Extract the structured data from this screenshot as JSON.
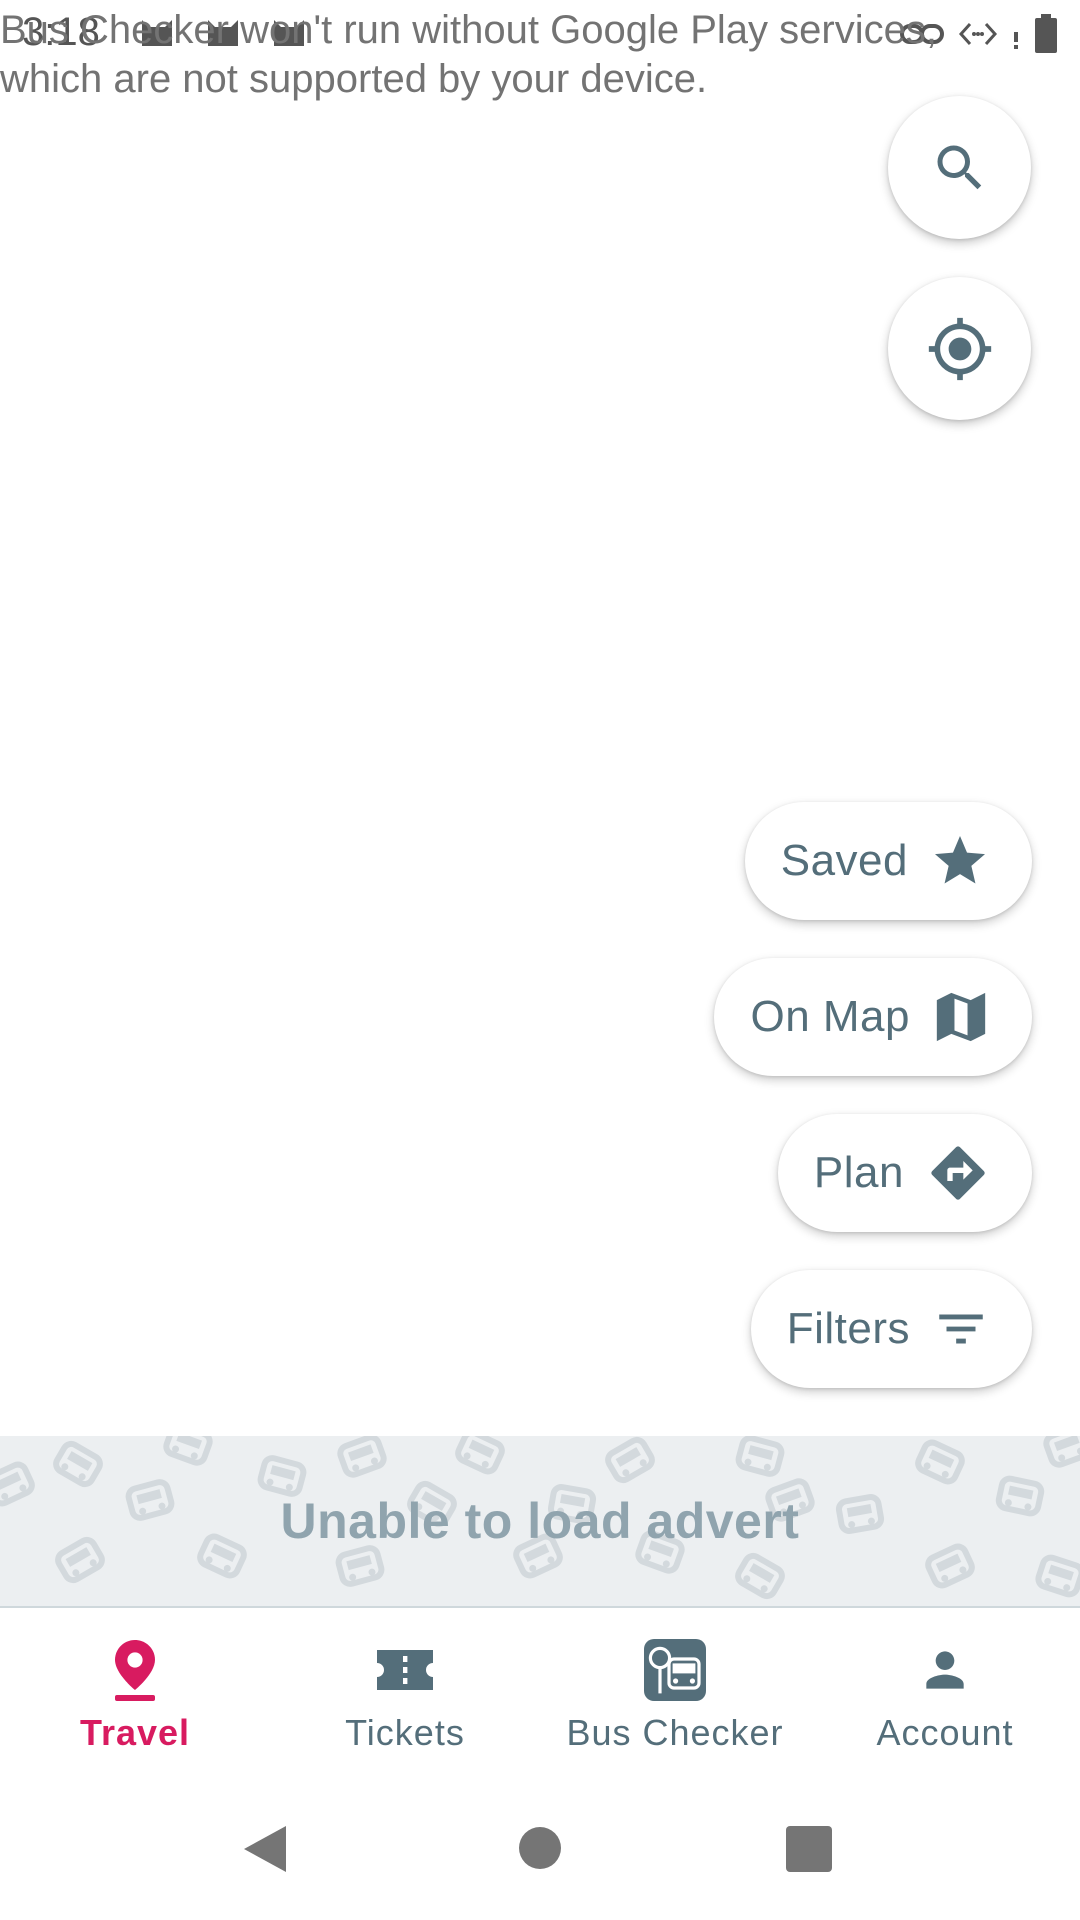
{
  "status_bar": {
    "time": "3:18"
  },
  "gp_message": "Bus Checker won't run without Google Play services, which are not supported by your device.",
  "fabs": {
    "search": "search-icon",
    "location": "my-location-icon"
  },
  "pills": {
    "saved": "Saved",
    "on_map": "On Map",
    "plan": "Plan",
    "filters": "Filters"
  },
  "advert": {
    "text": "Unable to load advert"
  },
  "nav": {
    "active": "Travel",
    "items": [
      {
        "label": "Travel",
        "icon": "location-pin-icon"
      },
      {
        "label": "Tickets",
        "icon": "ticket-icon"
      },
      {
        "label": "Bus Checker",
        "icon": "bus-stop-icon"
      },
      {
        "label": "Account",
        "icon": "person-icon"
      }
    ]
  },
  "colors": {
    "accent": "#d81b60",
    "icon": "#546e7a",
    "advert_bg": "#eceff1"
  }
}
